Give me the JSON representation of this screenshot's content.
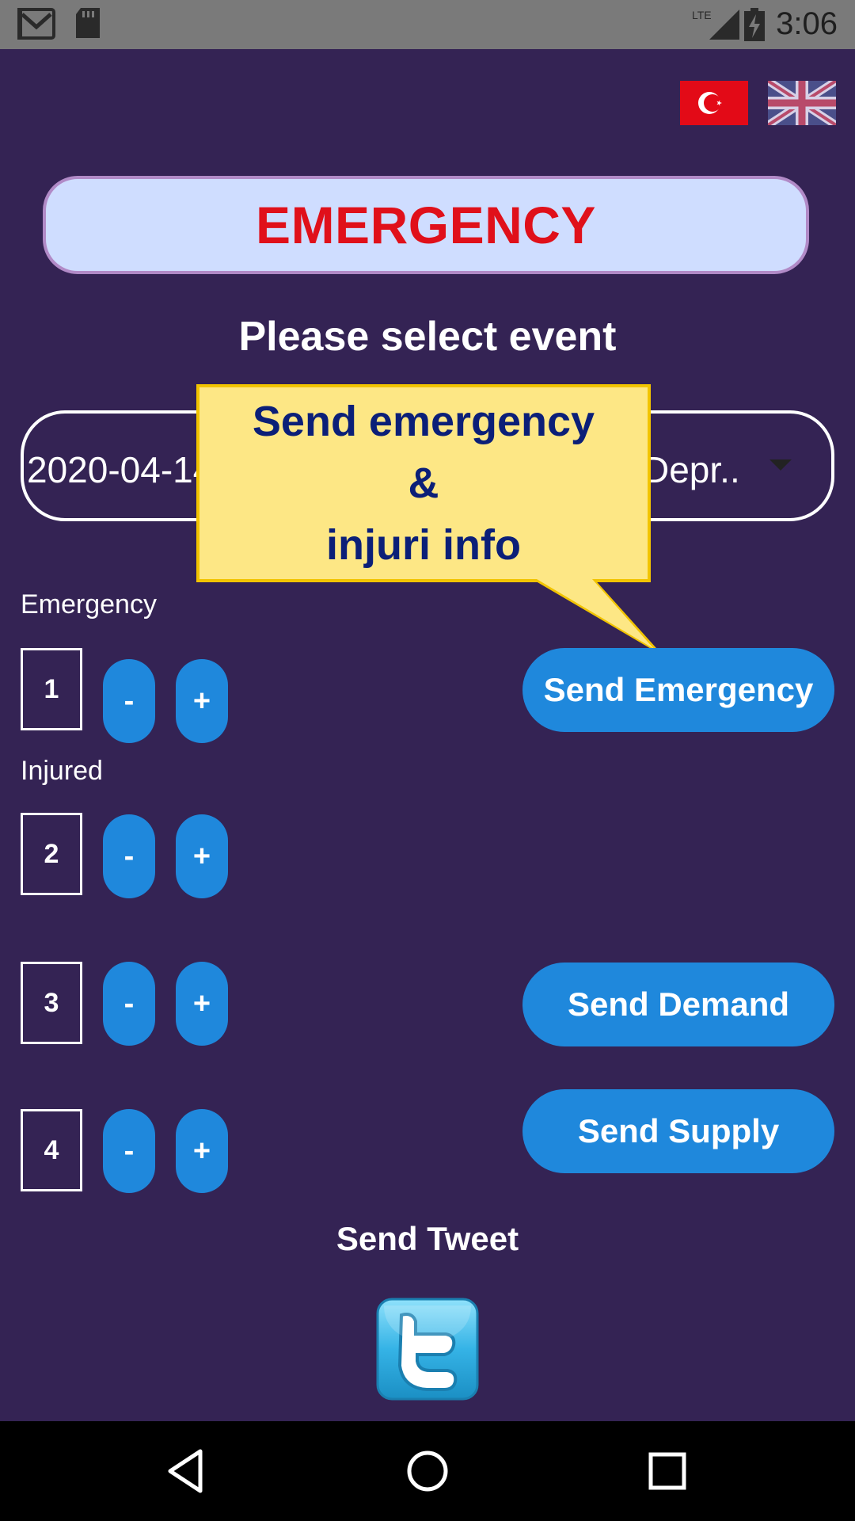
{
  "status_bar": {
    "time": "3:06",
    "network": "LTE",
    "icons": [
      "gmail-icon",
      "sd-card-icon",
      "signal-icon",
      "battery-charging-icon"
    ]
  },
  "languages": [
    {
      "name": "turkish-flag-icon"
    },
    {
      "name": "uk-flag-icon"
    }
  ],
  "banner": {
    "title": "EMERGENCY"
  },
  "select_prompt": "Please select event",
  "event_select": {
    "value": "2020-04-14 ......................................... Depr..",
    "visible_left": "2020-04-14",
    "visible_right": "Depr.."
  },
  "callout": {
    "line1": "Send emergency",
    "line2": "&",
    "line3": "injuri info"
  },
  "emergency": {
    "label": "Emergency",
    "count": "1",
    "minus": "-",
    "plus": "+",
    "send_label": "Send Emergency"
  },
  "injured": {
    "label": "Injured",
    "count": "2",
    "minus": "-",
    "plus": "+"
  },
  "demand": {
    "count": "3",
    "minus": "-",
    "plus": "+",
    "send_label": "Send Demand"
  },
  "supply": {
    "count": "4",
    "minus": "-",
    "plus": "+",
    "send_label": "Send Supply"
  },
  "tweet": {
    "title": "Send Tweet",
    "icon": "twitter-icon"
  },
  "colors": {
    "background": "#342354",
    "accent": "#1f88dc",
    "emergency_red": "#e0101a",
    "banner_bg": "#cfddff",
    "callout_bg": "#fde785",
    "callout_text": "#0b1f78"
  },
  "nav": [
    "back-icon",
    "home-icon",
    "recents-icon"
  ]
}
